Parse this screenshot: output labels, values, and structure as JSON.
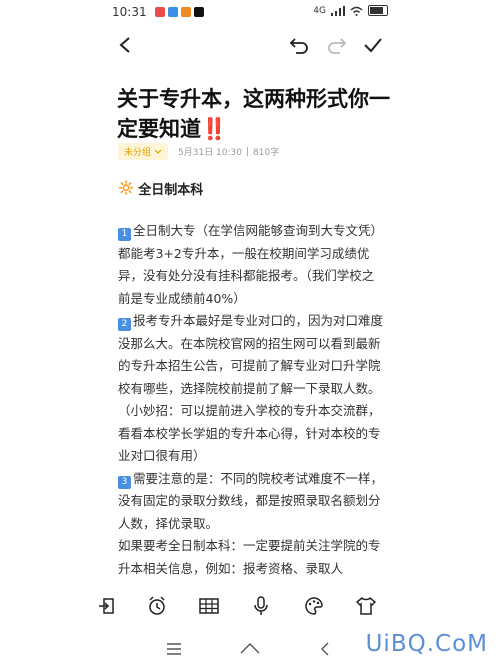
{
  "status_bar": {
    "time": "10:31",
    "network": "4G",
    "battery": "70"
  },
  "note": {
    "title": "关于专升本，这两种形式你一定要知道",
    "title_emoji": "‼️",
    "category": "未分组",
    "date": "5月31日 10:30",
    "word_count": "810字",
    "section_emoji": "🔆",
    "section_heading": "全日制本科",
    "paragraphs": [
      {
        "num": "1",
        "text": "全日制大专（在学信网能够查询到大专文凭）都能考3+2专升本，一般在校期间学习成绩优异，没有处分没有挂科都能报考。（我们学校之前是专业成绩前40%）"
      },
      {
        "num": "2",
        "text": "报考专升本最好是专业对口的，因为对口难度没那么大。在本院校官网的招生网可以看到最新的专升本招生公告，可提前了解专业对口升学院校有哪些，选择院校前提前了解一下录取人数。（小妙招：可以提前进入学校的专升本交流群，看看本校学长学姐的专升本心得，针对本校的专业对口很有用）"
      },
      {
        "num": "3",
        "text": "需要注意的是：不同的院校考试难度不一样，没有固定的录取分数线，都是按照录取名额划分人数，择优录取。"
      },
      {
        "num": "",
        "text": "如果要考全日制本科：一定要提前关注学院的专升本相关信息，例如：报考资格、录取人"
      }
    ]
  },
  "watermark": "UiBQ.CoM",
  "colors": {
    "accent": "#4a90e2",
    "category_bg": "#fff5d6",
    "category_text": "#e0a000"
  }
}
